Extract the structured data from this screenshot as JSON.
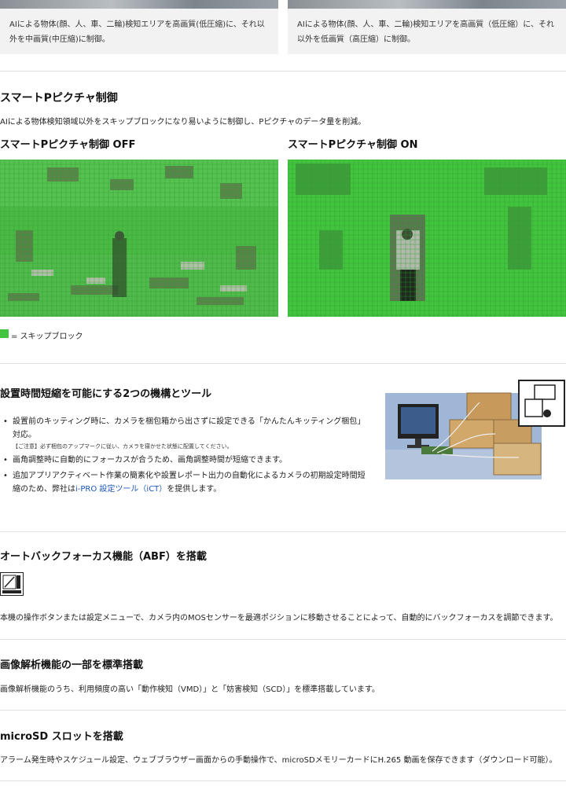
{
  "top": {
    "left_caption": "AIによる物体(顔、人、車、二輪)検知エリアを高画質(低圧縮)に、それ以外を中画質(中圧縮)に制御。",
    "right_caption": "AIによる物体(顔、人、車、二輪)検知エリアを高画質（低圧縮）に、それ以外を低画質（高圧縮）に制御。"
  },
  "smart_p": {
    "title": "スマートPピクチャ制御",
    "description": "AIによる物体検知領域以外をスキップブロックになり易いように制御し、Pピクチャのデータ量を削減。",
    "off_title": "スマートPピクチャ制御 OFF",
    "on_title": "スマートPピクチャ制御 ON",
    "legend": "= スキップブロック",
    "skip_color": "#43c43f"
  },
  "setup": {
    "title": "設置時間短縮を可能にする2つの機構とツール",
    "bullet1": "設置前のキッティング時に、カメラを梱包箱から出さずに設定できる「かんたんキッティング梱包」対応。",
    "note": "【ご注意】必ず梱包のアップマークに従い、カメラを寝かせた状態に配置してください。",
    "bullet2": "画角調整時に自動的にフォーカスが合うため、画角調整時間が短縮できます。",
    "bullet3_pre": "追加アプリアクティベート作業の簡素化や設置レポート出力の自動化によるカメラの初期設定時間短縮のため、弊社は",
    "bullet3_link": "i-PRO 設定ツール（iCT）",
    "bullet3_post": "を提供します。",
    "link_color": "#1a56b8"
  },
  "abf": {
    "title": "オートバックフォーカス機能（ABF）を搭載",
    "icon_label": "Auto Back Focus",
    "description": "本機の操作ボタンまたは設定メニューで、カメラ内のMOSセンサーを最適ポジションに移動させることによって、自動的にバックフォーカスを調節できます。"
  },
  "analysis": {
    "title": "画像解析機能の一部を標準搭載",
    "description": "画像解析機能のうち、利用頻度の高い「動作検知（VMD）」と「妨害検知（SCD）」を標準搭載しています。"
  },
  "microsd": {
    "title": "microSD スロットを搭載",
    "description": "アラーム発生時やスケジュール設定、ウェブブラウザー画面からの手動操作で、microSDメモリーカードにH.265 動画を保存できます（ダウンロード可能）。"
  }
}
